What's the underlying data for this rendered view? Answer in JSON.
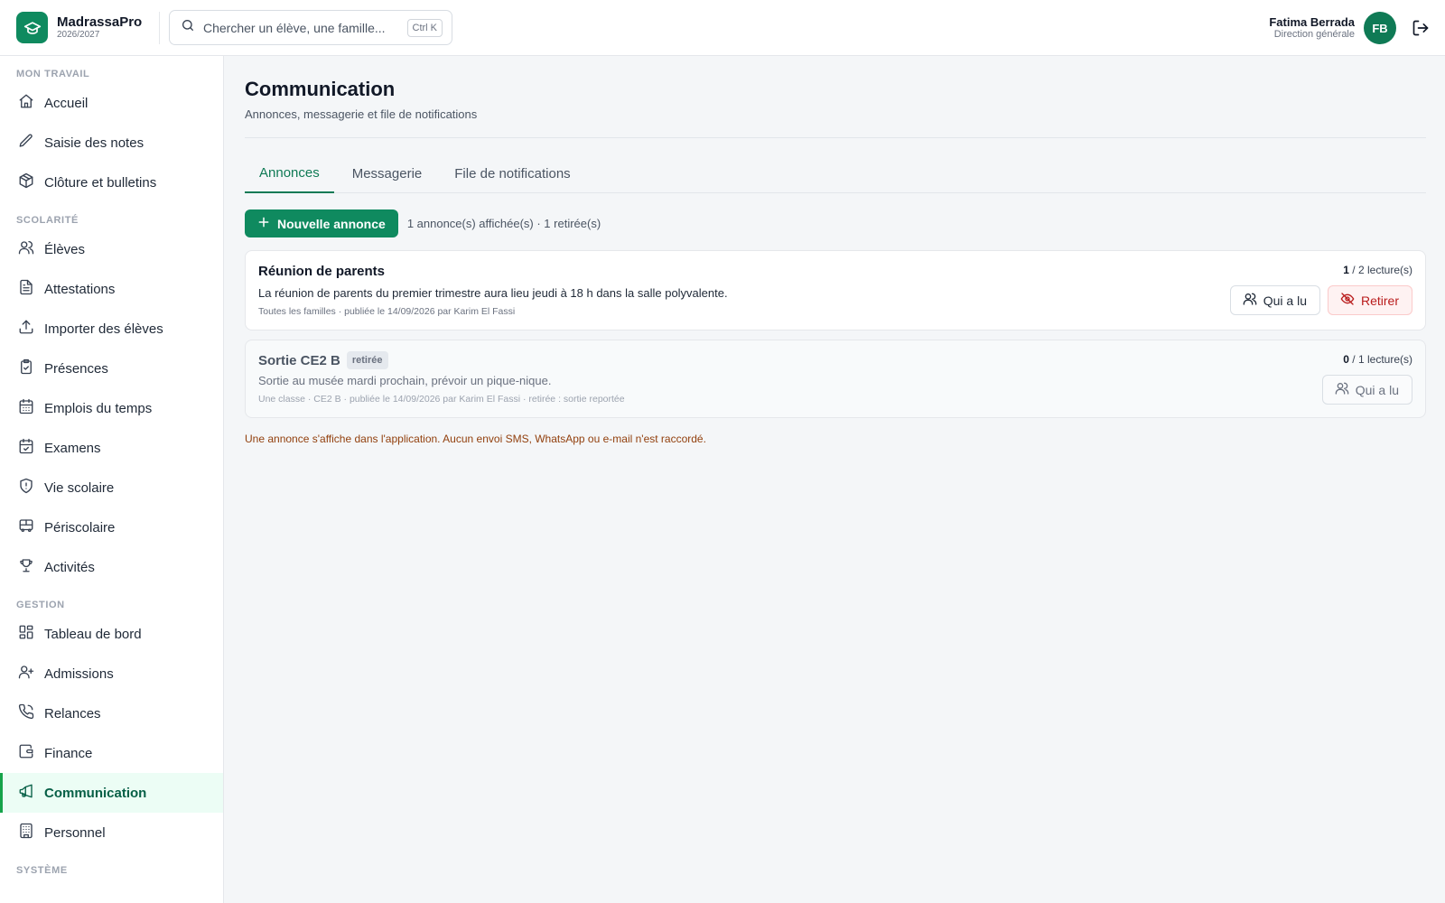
{
  "brand": {
    "name": "MadrassaPro",
    "year": "2026/2027"
  },
  "search": {
    "placeholder": "Chercher un élève, une famille...",
    "shortcut": "Ctrl K"
  },
  "user": {
    "name": "Fatima Berrada",
    "role": "Direction générale",
    "initials": "FB"
  },
  "sidebar": {
    "sections": [
      {
        "title": "MON TRAVAIL",
        "items": [
          {
            "label": "Accueil",
            "icon": "home-icon"
          },
          {
            "label": "Saisie des notes",
            "icon": "pencil-icon"
          },
          {
            "label": "Clôture et bulletins",
            "icon": "package-icon"
          }
        ]
      },
      {
        "title": "SCOLARITÉ",
        "items": [
          {
            "label": "Élèves",
            "icon": "users-icon"
          },
          {
            "label": "Attestations",
            "icon": "document-icon"
          },
          {
            "label": "Importer des élèves",
            "icon": "upload-icon"
          },
          {
            "label": "Présences",
            "icon": "clipboard-check-icon"
          },
          {
            "label": "Emplois du temps",
            "icon": "calendar-icon"
          },
          {
            "label": "Examens",
            "icon": "calendar-check-icon"
          },
          {
            "label": "Vie scolaire",
            "icon": "shield-icon"
          },
          {
            "label": "Périscolaire",
            "icon": "bus-icon"
          },
          {
            "label": "Activités",
            "icon": "trophy-icon"
          }
        ]
      },
      {
        "title": "GESTION",
        "items": [
          {
            "label": "Tableau de bord",
            "icon": "dashboard-icon"
          },
          {
            "label": "Admissions",
            "icon": "user-plus-icon"
          },
          {
            "label": "Relances",
            "icon": "phone-icon"
          },
          {
            "label": "Finance",
            "icon": "wallet-icon"
          },
          {
            "label": "Communication",
            "icon": "megaphone-icon",
            "active": true
          },
          {
            "label": "Personnel",
            "icon": "building-icon"
          }
        ]
      },
      {
        "title": "SYSTÈME",
        "items": []
      }
    ]
  },
  "page": {
    "title": "Communication",
    "subtitle": "Annonces, messagerie et file de notifications"
  },
  "tabs": [
    {
      "label": "Annonces",
      "active": true
    },
    {
      "label": "Messagerie",
      "active": false
    },
    {
      "label": "File de notifications",
      "active": false
    }
  ],
  "toolbar": {
    "new_label": "Nouvelle annonce",
    "count_text": "1 annonce(s) affichée(s) · 1 retirée(s)"
  },
  "announcements": [
    {
      "title": "Réunion de parents",
      "body": "La réunion de parents du premier trimestre aura lieu jeudi à 18 h dans la salle polyvalente.",
      "meta": "Toutes les familles · publiée le 14/09/2026 par Karim El Fassi",
      "reads_count": "1",
      "reads_total": " / 2 lecture(s)",
      "who_read_label": "Qui a lu",
      "withdraw_label": "Retirer"
    },
    {
      "title": "Sortie CE2 B",
      "badge": "retirée",
      "body": "Sortie au musée mardi prochain, prévoir un pique-nique.",
      "meta": "Une classe · CE2 B · publiée le 14/09/2026 par Karim El Fassi · retirée : sortie reportée",
      "reads_count": "0",
      "reads_total": " / 1 lecture(s)",
      "who_read_label": "Qui a lu"
    }
  ],
  "footnote": "Une annonce s'affiche dans l'application. Aucun envoi SMS, WhatsApp ou e-mail n'est raccordé.",
  "colors": {
    "accent": "#0f8a5f",
    "danger": "#b91c1c",
    "note": "#92400e"
  }
}
